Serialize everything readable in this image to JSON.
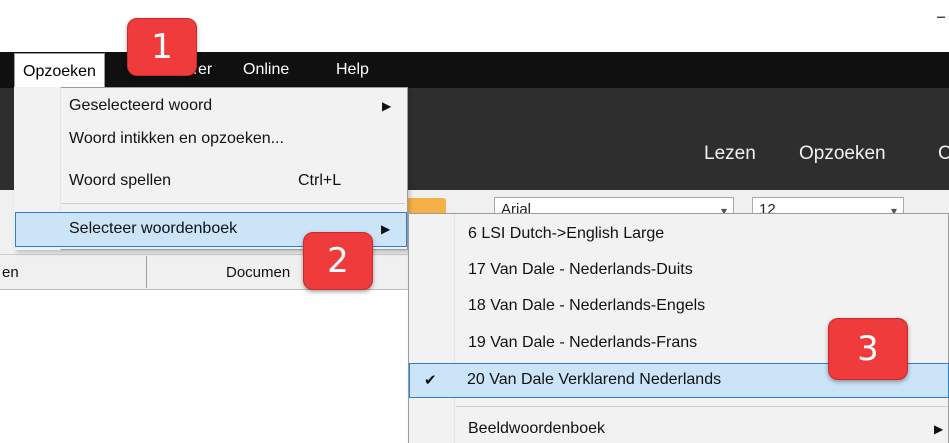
{
  "titlebar": {
    "minimize_glyph": "–"
  },
  "menubar": {
    "items": [
      {
        "label": "Opzoeken"
      },
      {
        "label": "…er"
      },
      {
        "label": "Online"
      },
      {
        "label": "Help"
      }
    ]
  },
  "ribbon": {
    "tabs": [
      {
        "label": "Lezen"
      },
      {
        "label": "Opzoeken"
      },
      {
        "label": "C"
      }
    ]
  },
  "toolbar": {
    "font_combo": "Arial",
    "size_combo": "12"
  },
  "statusbar": {
    "left_text": "en",
    "middle_text": "Documen"
  },
  "opzoeken_menu": {
    "items": [
      {
        "label": "Geselecteerd woord",
        "submenu": true
      },
      {
        "label": "Woord intikken en opzoeken...",
        "submenu": false
      },
      {
        "label": "Woord spellen",
        "shortcut": "Ctrl+L",
        "submenu": false
      },
      {
        "label": "Selecteer woordenboek",
        "submenu": true,
        "highlighted": true
      }
    ]
  },
  "woordenboek_menu": {
    "items": [
      {
        "label": "6 LSI Dutch->English Large",
        "checked": false
      },
      {
        "label": "17 Van Dale - Nederlands-Duits",
        "checked": false
      },
      {
        "label": "18 Van Dale - Nederlands-Engels",
        "checked": false
      },
      {
        "label": "19 Van Dale - Nederlands-Frans",
        "checked": false
      },
      {
        "label": "20 Van Dale Verklarend Nederlands",
        "checked": true
      },
      {
        "label": "Beeldwoordenboek",
        "submenu": true
      }
    ]
  },
  "annotations": {
    "badges": [
      "1",
      "2",
      "3"
    ],
    "badge_color": "#ef3b3b"
  },
  "colors": {
    "menubar_bg": "#101010",
    "ribbon_bg": "#2e2e2e",
    "highlight_bg": "#cce4f7",
    "highlight_border": "#2b80d6",
    "accent_orange": "#f6b048"
  }
}
